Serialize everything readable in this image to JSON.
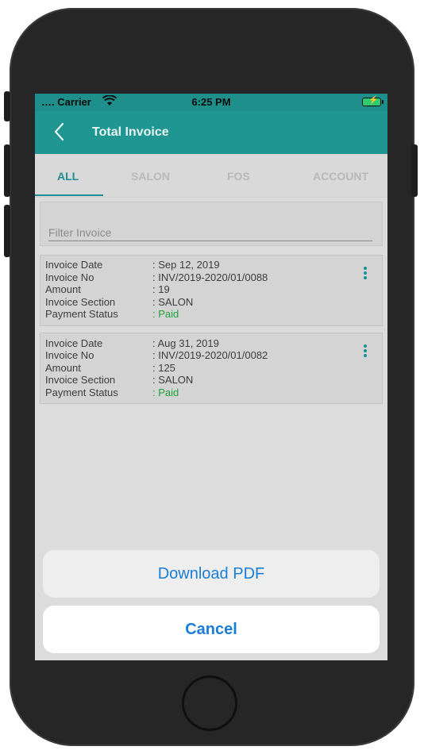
{
  "status_bar": {
    "carrier": "…. Carrier",
    "time": "6:25 PM",
    "wifi_icon": "wifi-icon",
    "battery_icon": "battery-charging-icon"
  },
  "header": {
    "title": "Total Invoice",
    "back_icon": "chevron-left-icon"
  },
  "tabs": [
    {
      "label": "ALL",
      "active": true
    },
    {
      "label": "SALON",
      "active": false
    },
    {
      "label": "FOS",
      "active": false
    },
    {
      "label": "ACCOUNT",
      "active": false
    }
  ],
  "filter": {
    "placeholder": "Filter Invoice",
    "value": ""
  },
  "labels": {
    "invoice_date": "Invoice Date",
    "invoice_no": "Invoice No",
    "amount": "Amount",
    "invoice_section": "Invoice Section",
    "payment_status": "Payment Status"
  },
  "invoices": [
    {
      "date": ": Sep 12, 2019",
      "number": ": INV/2019-2020/01/0088",
      "amount": ": 19",
      "section": ": SALON",
      "status": ": Paid"
    },
    {
      "date": ": Aug 31, 2019",
      "number": ": INV/2019-2020/01/0082",
      "amount": ": 125",
      "section": ": SALON",
      "status": ": Paid"
    }
  ],
  "action_sheet": {
    "download_label": "Download PDF",
    "cancel_label": "Cancel"
  },
  "colors": {
    "accent": "#1f9692",
    "paid": "#1ea13a",
    "action_text": "#1a7ed6"
  }
}
